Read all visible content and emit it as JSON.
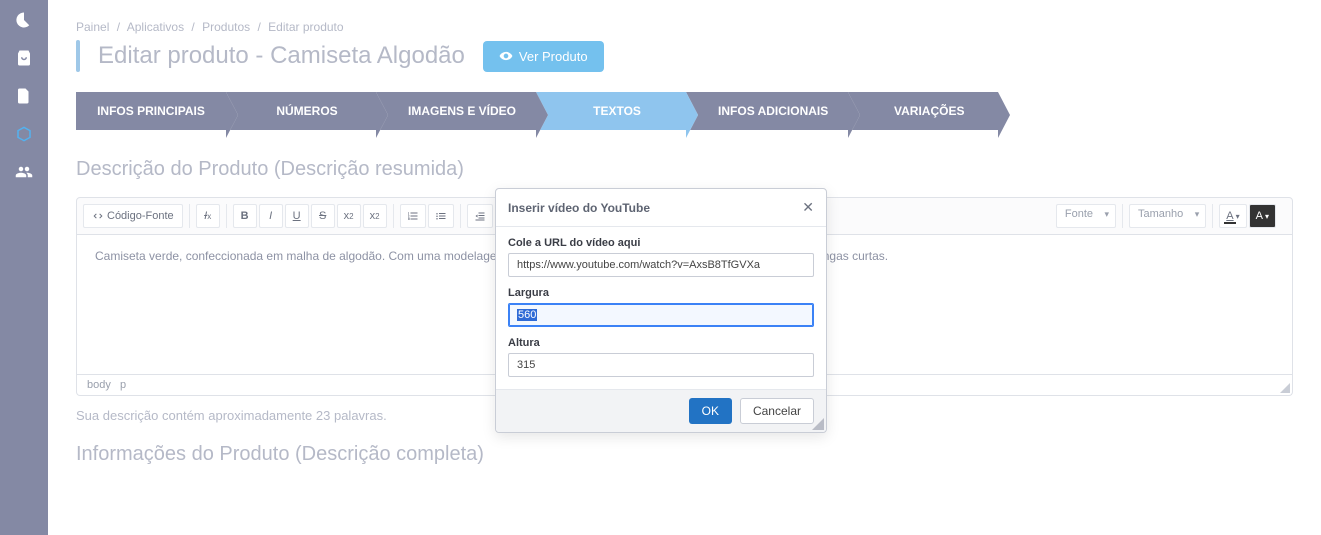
{
  "breadcrumb": {
    "painel": "Painel",
    "aplicativos": "Aplicativos",
    "produtos": "Produtos",
    "editar": "Editar produto"
  },
  "page_title": "Editar produto - Camiseta Algodão",
  "view_btn": "Ver Produto",
  "steps": {
    "s0": "INFOS PRINCIPAIS",
    "s1": "NÚMEROS",
    "s2": "IMAGENS E VÍDEO",
    "s3": "TEXTOS",
    "s4": "INFOS ADICIONAIS",
    "s5": "VARIAÇÕES"
  },
  "section1_title": "Descrição do Produto (Descrição resumida)",
  "toolbar": {
    "source": "Código-Fonte",
    "font_label": "Fonte",
    "size_label": "Tamanho"
  },
  "editor_text": "Camiseta verde, confeccionada em malha de algodão. Com uma modelagem regular fit e gola redonda em ribana, a camiseta possui mangas curtas.",
  "path_body": "body",
  "path_p": "p",
  "word_count": "Sua descrição contém aproximadamente 23 palavras.",
  "section2_title": "Informações do Produto (Descrição completa)",
  "dialog": {
    "title": "Inserir vídeo do YouTube",
    "url_label": "Cole a URL do vídeo aqui",
    "url_value": "https://www.youtube.com/watch?v=AxsB8TfGVXa",
    "width_label": "Largura",
    "width_value": "560",
    "height_label": "Altura",
    "height_value": "315",
    "ok": "OK",
    "cancel": "Cancelar"
  }
}
